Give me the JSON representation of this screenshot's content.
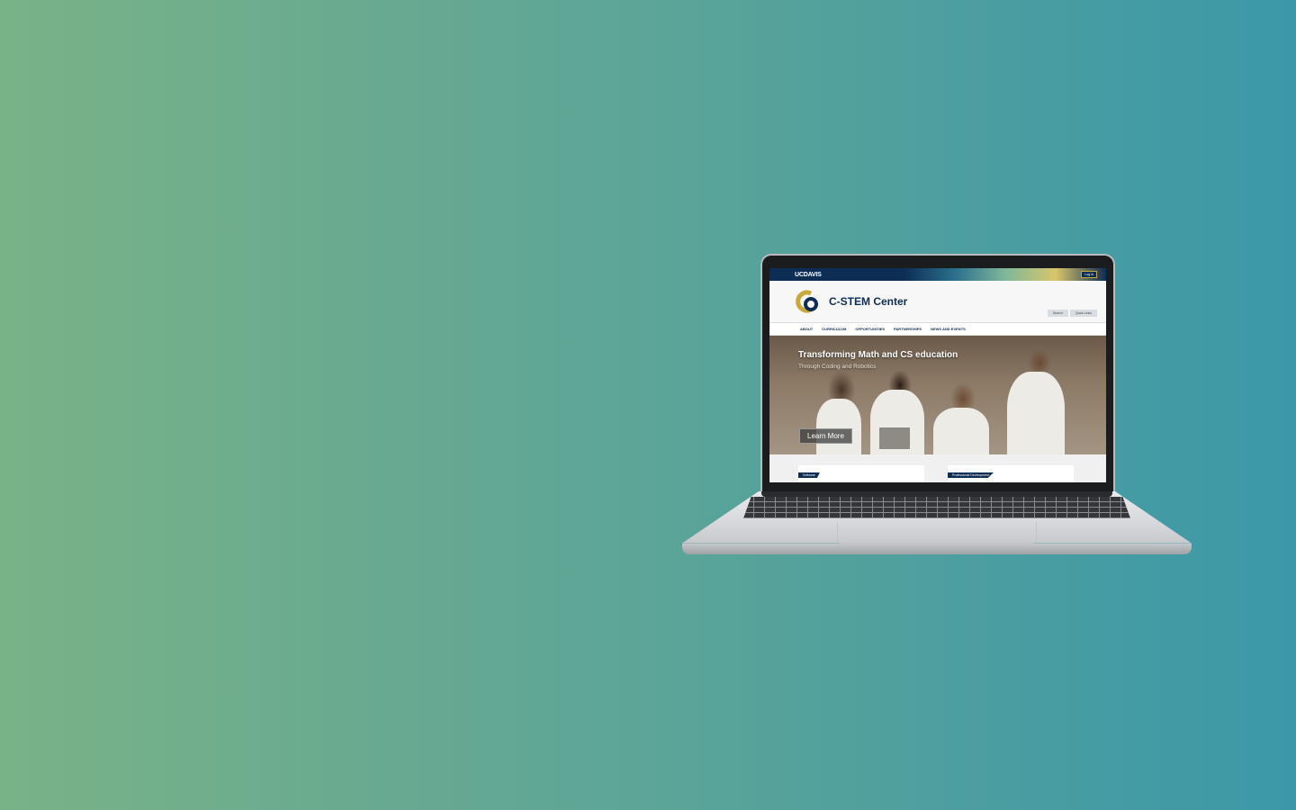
{
  "site": {
    "topbar": {
      "university_logo": "UCDAVIS",
      "login_label": "Log In"
    },
    "header": {
      "logo_icon": "c-stem-logo",
      "site_name": "C-STEM Center",
      "search_label": "Search",
      "quick_links_label": "Quick Links"
    },
    "nav": {
      "items": [
        {
          "label": "ABOUT"
        },
        {
          "label": "CURRICULUM"
        },
        {
          "label": "OPPORTUNITIES"
        },
        {
          "label": "PARTNERSHIPS"
        },
        {
          "label": "NEWS AND EVENTS"
        }
      ]
    },
    "hero": {
      "title": "Transforming Math and CS education",
      "subtitle": "Through Coding and Robotics",
      "cta_label": "Learn More"
    },
    "cards": [
      {
        "tab_label": "Software"
      },
      {
        "tab_label": "Professional Development"
      }
    ]
  },
  "colors": {
    "brand_navy": "#0e2d54",
    "brand_gold": "#c9a93b",
    "background_start": "#79b287",
    "background_end": "#3c98a8"
  }
}
